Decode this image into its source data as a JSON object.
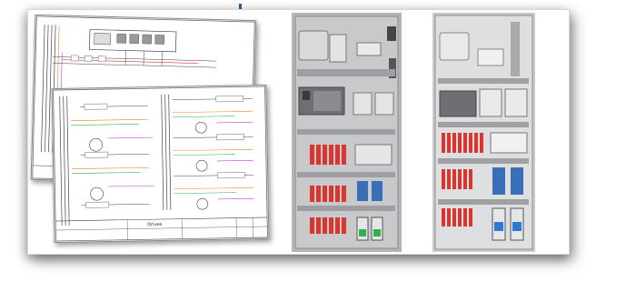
{
  "drawing": {
    "sheet_title": "Drives"
  },
  "colors": {
    "frame_shadow": "#555555",
    "sheet_line": "#444444",
    "wire_green": "#2bb34a",
    "wire_magenta": "#c23bd3",
    "wire_orange": "#e08a2c",
    "breaker_red": "#d8362f",
    "drive_blue": "#3a6fb8",
    "plc_gray": "#6d6f72"
  },
  "icons": [
    "schematic-sheet-icon",
    "control-panel-icon",
    "motor-symbol-icon"
  ]
}
